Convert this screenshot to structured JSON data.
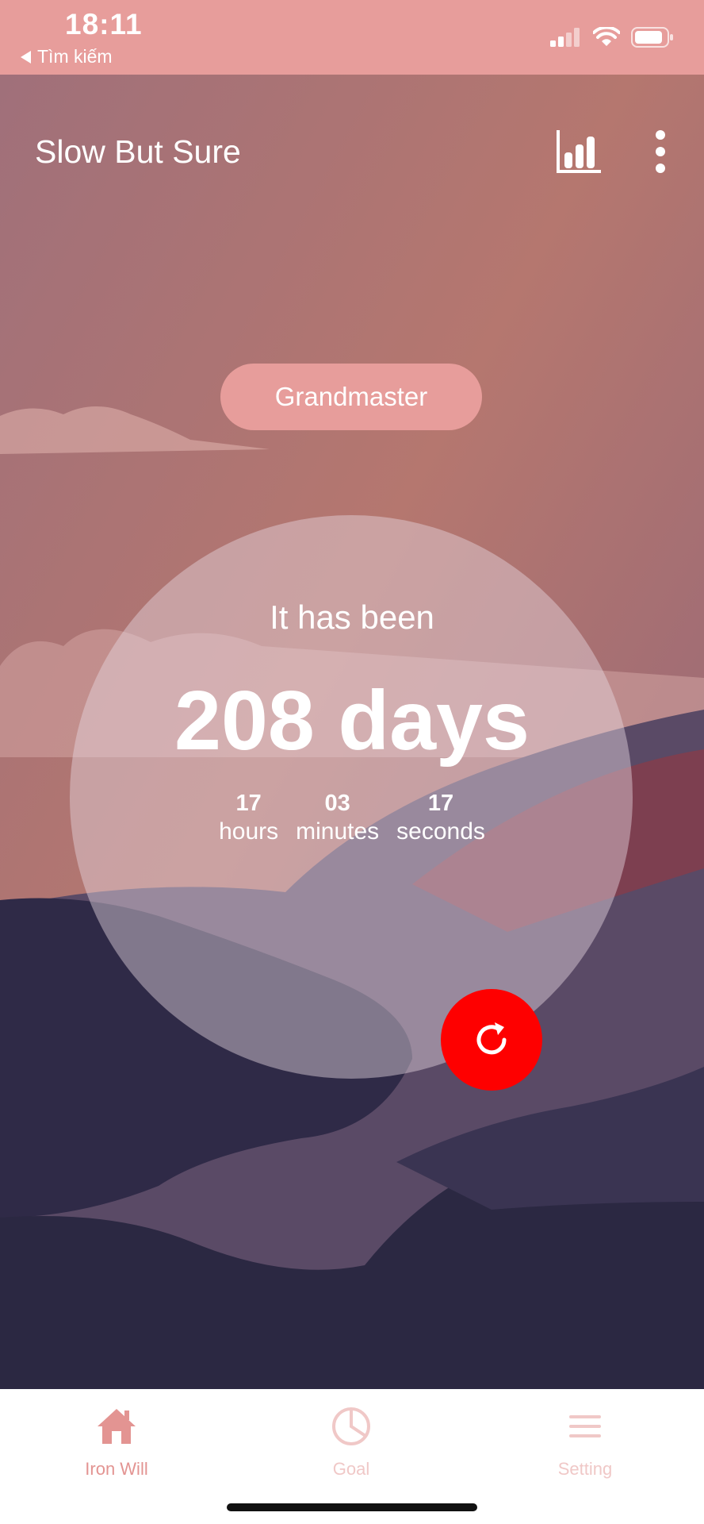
{
  "status_bar": {
    "time": "18:11",
    "back_label": "Tìm kiếm"
  },
  "header": {
    "title": "Slow But Sure",
    "stats_icon": "bar-chart-icon",
    "menu_icon": "more-vertical-icon"
  },
  "rank": {
    "label": "Grandmaster"
  },
  "timer": {
    "intro": "It has been",
    "days": "208 days",
    "hours_value": "17",
    "hours_label": "hours",
    "minutes_value": "03",
    "minutes_label": "minutes",
    "seconds_value": "17",
    "seconds_label": "seconds"
  },
  "reset_icon": "refresh-icon",
  "tabs": [
    {
      "label": "Iron Will",
      "icon": "home-icon",
      "active": true
    },
    {
      "label": "Goal",
      "icon": "pie-chart-icon",
      "active": false
    },
    {
      "label": "Setting",
      "icon": "menu-lines-icon",
      "active": false
    }
  ],
  "colors": {
    "status_bar": "#e79d9b",
    "accent": "#e79d9b",
    "reset_button": "#fe0000",
    "tab_active": "#e39492",
    "tab_inactive": "#f0c8c7"
  }
}
